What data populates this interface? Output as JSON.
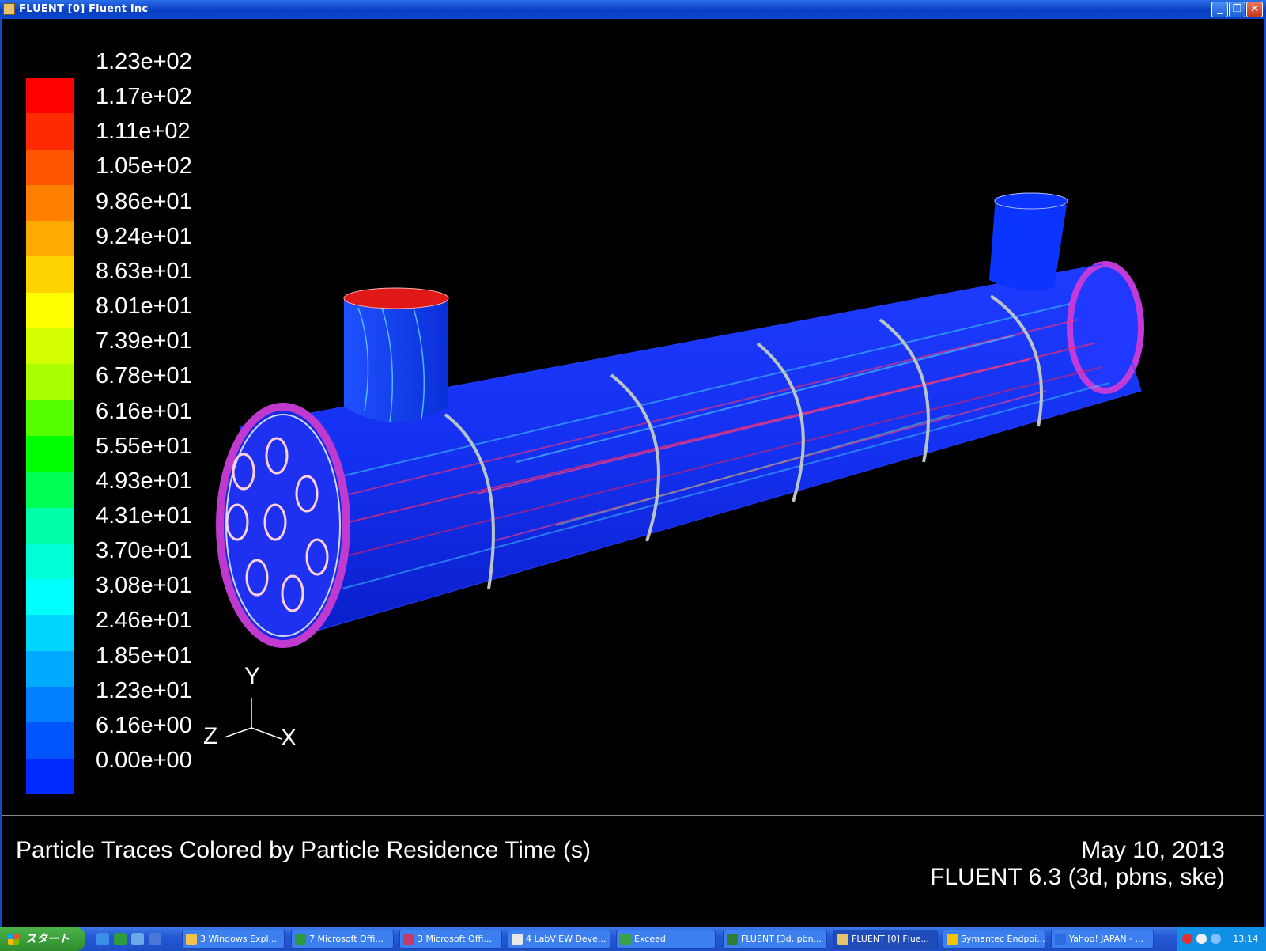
{
  "window": {
    "title": "FLUENT [0] Fluent Inc",
    "minimize": "_",
    "restore": "❐",
    "close": "✕"
  },
  "legend": {
    "labels": [
      "1.23e+02",
      "1.17e+02",
      "1.11e+02",
      "1.05e+02",
      "9.86e+01",
      "9.24e+01",
      "8.63e+01",
      "8.01e+01",
      "7.39e+01",
      "6.78e+01",
      "6.16e+01",
      "5.55e+01",
      "4.93e+01",
      "4.31e+01",
      "3.70e+01",
      "3.08e+01",
      "2.46e+01",
      "1.85e+01",
      "1.23e+01",
      "6.16e+00",
      "0.00e+00"
    ],
    "colors": [
      "#ff0000",
      "#ff2a00",
      "#ff5500",
      "#ff7f00",
      "#ffaa00",
      "#ffd400",
      "#ffff00",
      "#d4ff00",
      "#aaff00",
      "#55ff00",
      "#00ff00",
      "#00ff55",
      "#00ffaa",
      "#00ffd4",
      "#00ffff",
      "#00d4ff",
      "#00aaff",
      "#007fff",
      "#0055ff",
      "#002aff"
    ]
  },
  "axes": {
    "y": "Y",
    "z": "Z",
    "x": "X"
  },
  "caption": {
    "title": "Particle Traces Colored by Particle Residence Time (s)",
    "date": "May 10, 2013",
    "version": "FLUENT 6.3 (3d, pbns, ske)"
  },
  "taskbar": {
    "start": "スタート",
    "tasks": [
      {
        "label": "3 Windows Expl...",
        "color": "#f2c14e"
      },
      {
        "label": "7 Microsoft Offi...",
        "color": "#2e9b3e"
      },
      {
        "label": "3 Microsoft Offi...",
        "color": "#c23b6a"
      },
      {
        "label": "4 LabVIEW Deve...",
        "color": "#e8e8e8"
      },
      {
        "label": "Exceed",
        "color": "#3aa04a"
      },
      {
        "label": "FLUENT  [3d, pbn...",
        "color": "#2f7d33"
      },
      {
        "label": "FLUENT [0] Flue...",
        "color": "#e9c36c"
      },
      {
        "label": "Symantec Endpoi...",
        "color": "#f5c400"
      },
      {
        "label": "Yahoo! JAPAN - ...",
        "color": "#2b6de0"
      }
    ],
    "clock": "13:14"
  }
}
